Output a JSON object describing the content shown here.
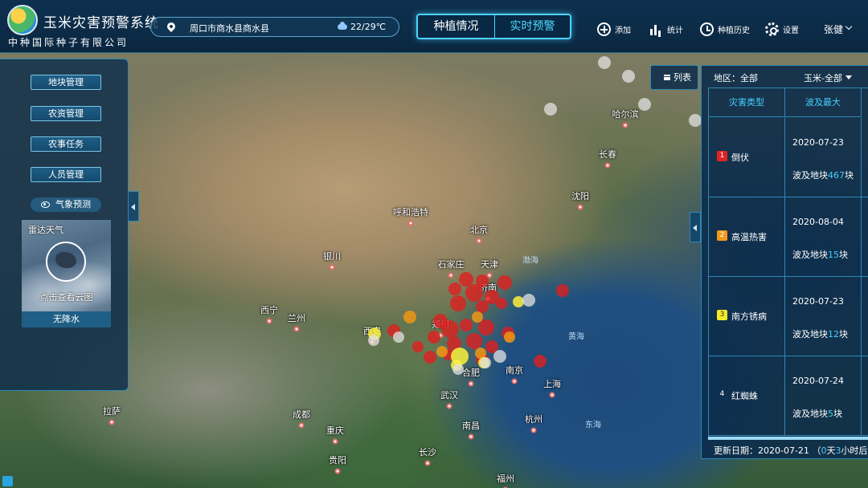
{
  "header": {
    "app_title": "玉米灾害预警系统",
    "company": "中种国际种子有限公司",
    "location": "周口市商水县商水县",
    "weather": "22/29℃",
    "tabs": [
      "种植情况",
      "实时预警"
    ],
    "active_tab": "实时预警",
    "toolbar": {
      "add": "添加",
      "stats": "统计",
      "history": "种植历史",
      "settings": "设置"
    },
    "user": "张健"
  },
  "left_panel": {
    "menu": [
      "地块管理",
      "农资管理",
      "农事任务",
      "人员管理"
    ],
    "weather_forecast_button": "气象预测",
    "weather_card_title": "雷达天气",
    "weather_card_hint": "点击查看云图",
    "weather_status": "无降水"
  },
  "map": {
    "places": [
      "哈尔滨",
      "长春",
      "呼和浩特",
      "北京",
      "沈阳",
      "银川",
      "石家庄",
      "天津",
      "济南",
      "西宁",
      "兰州",
      "西安",
      "郑州",
      "南京",
      "上海",
      "武汉",
      "合肥",
      "杭州",
      "成都",
      "重庆",
      "长沙",
      "南昌",
      "贵阳",
      "福州",
      "拉萨"
    ],
    "seas": [
      "渤海",
      "黄海",
      "东海"
    ]
  },
  "right_panel": {
    "list_button": "列表",
    "region_filter": "地区：全部",
    "crop_filter": "玉米-全部",
    "columns": [
      "灾害类型",
      "波及最大"
    ],
    "rows": [
      {
        "rank": "1",
        "type": "倒伏",
        "date": "2020-07-23",
        "prefix": "波及地块",
        "count": "467",
        "suffix": "块",
        "color": "#e02323"
      },
      {
        "rank": "2",
        "type": "高温热害",
        "date": "2020-08-04",
        "prefix": "波及地块",
        "count": "15",
        "suffix": "块",
        "color": "#f09a1a"
      },
      {
        "rank": "3",
        "type": "南方锈病",
        "date": "2020-07-23",
        "prefix": "波及地块",
        "count": "12",
        "suffix": "块",
        "color": "#f5ea2a"
      },
      {
        "rank": "4",
        "type": "红蜘蛛",
        "date": "2020-07-24",
        "prefix": "波及地块",
        "count": "5",
        "suffix": "块",
        "color": ""
      }
    ],
    "footer_label": "更新日期：2020-07-21",
    "footer_paren": "（",
    "footer_days": "0",
    "footer_day_unit": "天",
    "footer_hours": "3",
    "footer_tail": "小时后更"
  }
}
